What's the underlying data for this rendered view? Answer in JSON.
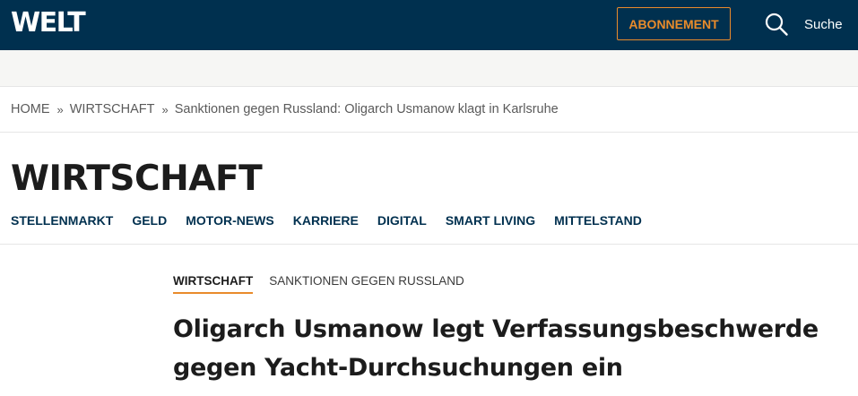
{
  "header": {
    "logo": "WELT",
    "subscribe_label": "ABONNEMENT",
    "search_icon": "search-icon",
    "search_label": "Suche"
  },
  "breadcrumb": {
    "items": [
      "HOME",
      "WIRTSCHAFT",
      "Sanktionen gegen Russland: Oligarch Usmanow klagt in Karlsruhe"
    ],
    "separator": "»"
  },
  "section": {
    "title": "WIRTSCHAFT",
    "subnav": [
      "STELLENMARKT",
      "GELD",
      "MOTOR-NEWS",
      "KARRIERE",
      "DIGITAL",
      "SMART LIVING",
      "MITTELSTAND"
    ]
  },
  "article": {
    "kicker_section": "WIRTSCHAFT",
    "kicker_topic": "SANKTIONEN GEGEN RUSSLAND",
    "headline": "Oligarch Usmanow legt Verfassungsbeschwerde gegen Yacht-Durchsuchungen ein"
  },
  "colors": {
    "header_bg": "#00304f",
    "accent": "#e98b2b",
    "nav_text": "#00304f"
  }
}
